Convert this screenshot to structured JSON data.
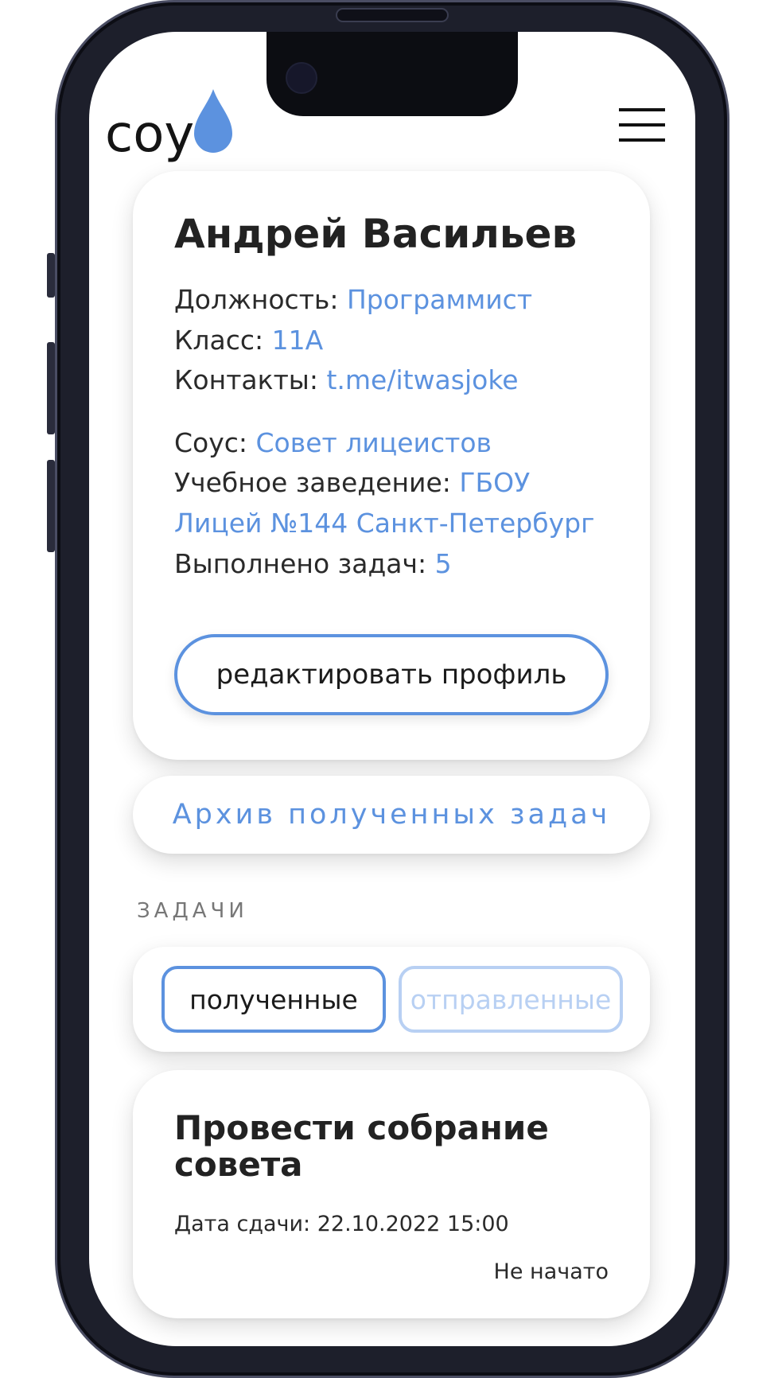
{
  "app": {
    "logo_text": "соус",
    "accent_color": "#5c92df",
    "accent_light": "#b8d0f3"
  },
  "header": {
    "menu_icon": "hamburger-menu-icon"
  },
  "profile": {
    "name": "Андрей Васильев",
    "position_label": "Должность: ",
    "position_value": "Программист",
    "class_label": "Класс: ",
    "class_value": "11А",
    "contacts_label": "Контакты: ",
    "contacts_value": "t.me/itwasjoke",
    "sous_label": "Соус: ",
    "sous_value": "Совет лицеистов",
    "school_label": "Учебное заведение: ",
    "school_value_line1": "ГБОУ",
    "school_value_line2": "Лицей №144 Санкт-Петербург",
    "tasks_done_label": "Выполнено задач: ",
    "tasks_done_value": "5",
    "edit_button": "редактировать профиль"
  },
  "archive": {
    "label": "Архив полученных задач"
  },
  "tasks": {
    "section_label": "ЗАДАЧИ",
    "tabs": [
      {
        "label": "полученные",
        "active": true
      },
      {
        "label": "отправленные",
        "active": false
      }
    ],
    "items": [
      {
        "title": "Провести собрание совета",
        "due": "Дата сдачи: 22.10.2022 15:00",
        "status": "Не начато"
      }
    ]
  }
}
